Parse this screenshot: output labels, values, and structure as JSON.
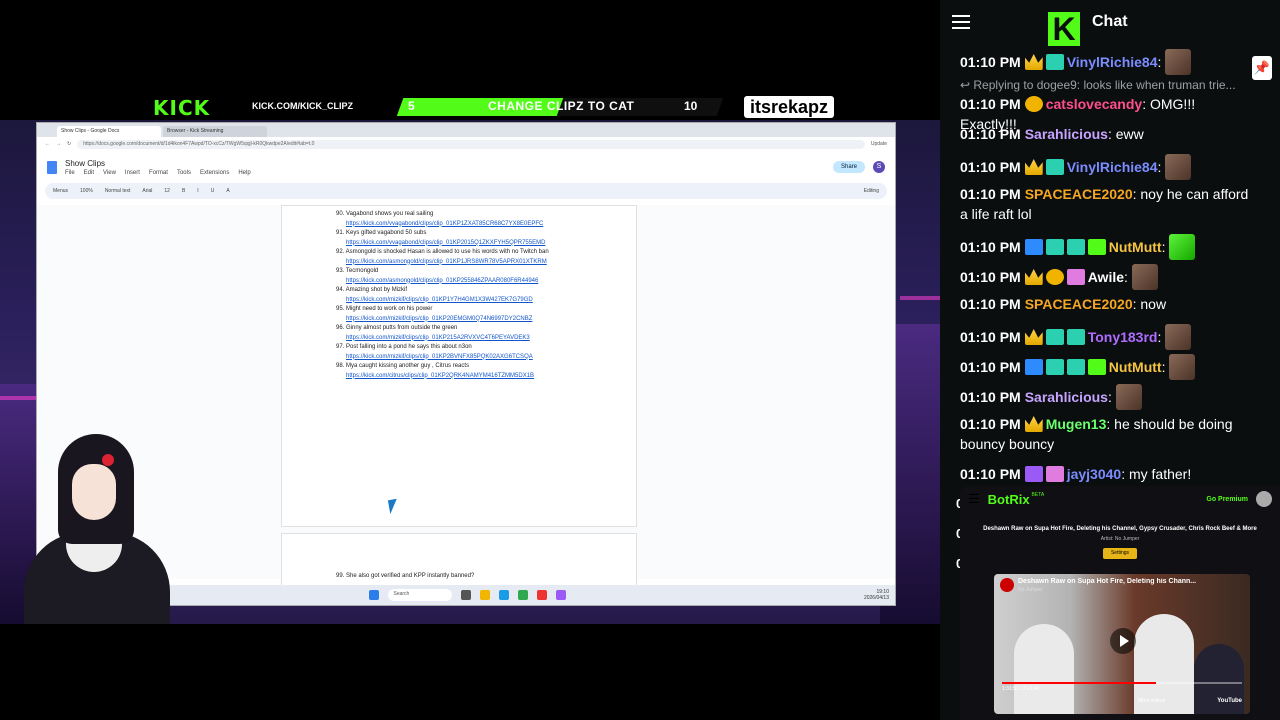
{
  "overlay": {
    "kick_logo": "KICK",
    "kick_url": "KICK.COM/KICK_CLIPZ",
    "goal_current": "5",
    "goal_text": "CHANGE CLIPZ TO CAT",
    "goal_target": "10",
    "goal_progress_fraction": 0.5,
    "handle": "itsrekapz",
    "accent_color": "#53fc18"
  },
  "browser": {
    "tabs": [
      "Show Clips - Google Docs",
      "Browser - Kick Streaming"
    ],
    "url": "https://docs.google.com/document/d/1d4ikon4F7Awpd/TO-xcCz/TWgW5qqjl-kR0Qkwdpe2A/edit#tab=t.0",
    "update_label": "Update",
    "docs": {
      "title": "Show Clips",
      "menu": [
        "File",
        "Edit",
        "View",
        "Insert",
        "Format",
        "Tools",
        "Extensions",
        "Help"
      ],
      "share_label": "Share",
      "avatar_letter": "S",
      "toolbar": [
        "Menus",
        "100%",
        "Normal text",
        "Arial",
        "12",
        "B",
        "I",
        "U",
        "A",
        "Editing"
      ],
      "entries": [
        {
          "title": "90. Vagabond shows you real sailing",
          "link": "https://kick.com/vvagabond/clips/clip_01KP1ZXAT85CR68C7YX8E0EPFC"
        },
        {
          "title": "91. Keys gifted vagabond 50 subs",
          "link": "https://kick.com/vvagabond/clips/clip_01KP2015Q1ZKXFYH5QPR755EMD"
        },
        {
          "title": "92. Asmongold is shocked Hasan is allowed to use his words with no Twitch ban",
          "link": "https://kick.com/asmongold/clips/clip_01KP1JRS8WR78V5APRX01XTKRM"
        },
        {
          "title": "93. Tecmongold",
          "link": "https://kick.com/asmongold/clips/clip_01KP255846ZPAAR080F6R44946"
        },
        {
          "title": "94. Amazing shot by Mizkif",
          "link": "https://kick.com/mizkif/clips/clip_01KP1Y7H4GM1X3W427EK7G79GD"
        },
        {
          "title": "95. Might need to work on his power",
          "link": "https://kick.com/mizkif/clips/clip_01KP20EMGM0Q74N6997DY2CNBZ"
        },
        {
          "title": "96. Ginny almost putts from outside the green",
          "link": "https://kick.com/mizkif/clips/clip_01KP215A2RVXVC4T6PEYAVDEK3"
        },
        {
          "title": "97. Post falling into a pond he says this about n3on",
          "link": "https://kick.com/mizkif/clips/clip_01KP2BVNFX85PQK02AXG6TCSQA"
        },
        {
          "title": "98. Mya caught kissing another guy , Citrus reacts",
          "link": "https://kick.com/citrus/clips/clip_01KP2QRK4NAMYM416TZMM5DX1B"
        }
      ],
      "next_entry": "99. She also got verified and KPP instantly banned?"
    },
    "taskbar": {
      "search_label": "Search",
      "clock_time": "19:10",
      "clock_date": "2026/04/13"
    }
  },
  "chat": {
    "title": "Chat",
    "reply_text": "Replying to dogee9: looks like when truman trie...",
    "messages": [
      {
        "time": "01:10 PM",
        "user": "VinylRichie84",
        "color": "#7b8cff",
        "text": "",
        "badges": [
          "crown",
          "teal"
        ],
        "emote": true
      },
      {
        "time": "01:10 PM",
        "user": "catslovecandy",
        "color": "#ff4f8b",
        "text": "OMG!!! Exactly!!!",
        "badges": [
          "gold"
        ],
        "emote": false
      },
      {
        "time": "01:10 PM",
        "user": "Sarahlicious",
        "color": "#c7a4ff",
        "text": "eww",
        "badges": [],
        "emote": false
      },
      {
        "time": "01:10 PM",
        "user": "VinylRichie84",
        "color": "#7b8cff",
        "text": "",
        "badges": [
          "crown",
          "teal"
        ],
        "emote": true
      },
      {
        "time": "01:10 PM",
        "user": "SPACEACE2020",
        "color": "#f5a623",
        "text": "noy he can afford a life raft lol",
        "badges": [],
        "emote": false
      },
      {
        "time": "01:10 PM",
        "user": "NutMutt",
        "color": "#f5c542",
        "text": "",
        "badges": [
          "blue",
          "teal",
          "teal",
          "green"
        ],
        "emote": "heck"
      },
      {
        "time": "01:10 PM",
        "user": "Awile",
        "color": "#ffffff",
        "text": "",
        "badges": [
          "crown",
          "gold",
          "pink"
        ],
        "emote": true
      },
      {
        "time": "01:10 PM",
        "user": "SPACEACE2020",
        "color": "#f5a623",
        "text": "now",
        "badges": [],
        "emote": false
      },
      {
        "time": "01:10 PM",
        "user": "Tony183rd",
        "color": "#b06cff",
        "text": "",
        "badges": [
          "crown",
          "teal",
          "teal"
        ],
        "emote": true
      },
      {
        "time": "01:10 PM",
        "user": "NutMutt",
        "color": "#f5c542",
        "text": "",
        "badges": [
          "blue",
          "teal",
          "teal",
          "green"
        ],
        "emote": true
      },
      {
        "time": "01:10 PM",
        "user": "Sarahlicious",
        "color": "#c7a4ff",
        "text": "",
        "badges": [],
        "emote": true
      },
      {
        "time": "01:10 PM",
        "user": "Mugen13",
        "color": "#6bff6b",
        "text": "he should be doing bouncy bouncy",
        "badges": [
          "crown"
        ],
        "emote": false
      },
      {
        "time": "01:10 PM",
        "user": "jayj3040",
        "color": "#7b8cff",
        "text": "my father!",
        "badges": [
          "purple",
          "pink"
        ],
        "emote": false
      }
    ]
  },
  "botrix": {
    "name": "BotRix",
    "beta": "BETA",
    "premium_label": "Go Premium",
    "now_playing": "Deshawn Raw on Supa Hot Fire, Deleting his Channel, Gypsy Crusader, Chris Rock Beef & More",
    "artist": "Artist: No Jumper",
    "settings_label": "Settings",
    "video_title": "Deshawn Raw on Supa Hot Fire, Deleting his Chann...",
    "channel": "No Jumper",
    "time": "1:31:51 / 2:22:42",
    "progress_fraction": 0.64,
    "more_videos": "More videos",
    "youtube": "YouTube"
  }
}
